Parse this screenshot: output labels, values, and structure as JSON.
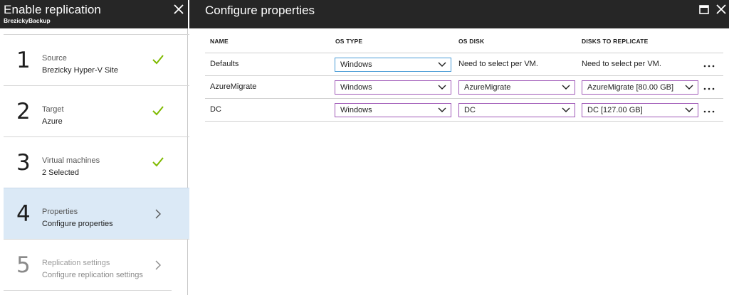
{
  "left_blade": {
    "title": "Enable replication",
    "subtitle": "BrezickyBackup",
    "steps": [
      {
        "number": "1",
        "title": "Source",
        "value": "Brezicky Hyper-V Site",
        "state": "complete"
      },
      {
        "number": "2",
        "title": "Target",
        "value": "Azure",
        "state": "complete"
      },
      {
        "number": "3",
        "title": "Virtual machines",
        "value": "2 Selected",
        "state": "complete"
      },
      {
        "number": "4",
        "title": "Properties",
        "value": "Configure properties",
        "state": "active"
      },
      {
        "number": "5",
        "title": "Replication settings",
        "value": "Configure replication settings",
        "state": "disabled"
      }
    ]
  },
  "right_blade": {
    "title": "Configure properties",
    "columns": [
      "NAME",
      "OS TYPE",
      "OS DISK",
      "DISKS TO REPLICATE"
    ],
    "rows": [
      {
        "name": "Defaults",
        "os_type": "Windows",
        "os_disk": "Need to select per VM.",
        "disks": "Need to select per VM."
      },
      {
        "name": "AzureMigrate",
        "os_type": "Windows",
        "os_disk": "AzureMigrate",
        "disks": "AzureMigrate [80.00 GB]"
      },
      {
        "name": "DC",
        "os_type": "Windows",
        "os_disk": "DC",
        "disks": "DC [127.00 GB]"
      }
    ]
  },
  "colors": {
    "header_bg": "#262626",
    "active_step_bg": "#dbe9f6",
    "check_green": "#7fba00",
    "dropdown_border": "#a05ab8",
    "dropdown_focus_border": "#4a9cd6"
  },
  "icons": {
    "close": "close-icon",
    "maximize": "maximize-icon",
    "check": "checkmark-icon",
    "chevron_right": "chevron-right-icon",
    "chevron_down": "chevron-down-icon",
    "more": "ellipsis-icon"
  }
}
